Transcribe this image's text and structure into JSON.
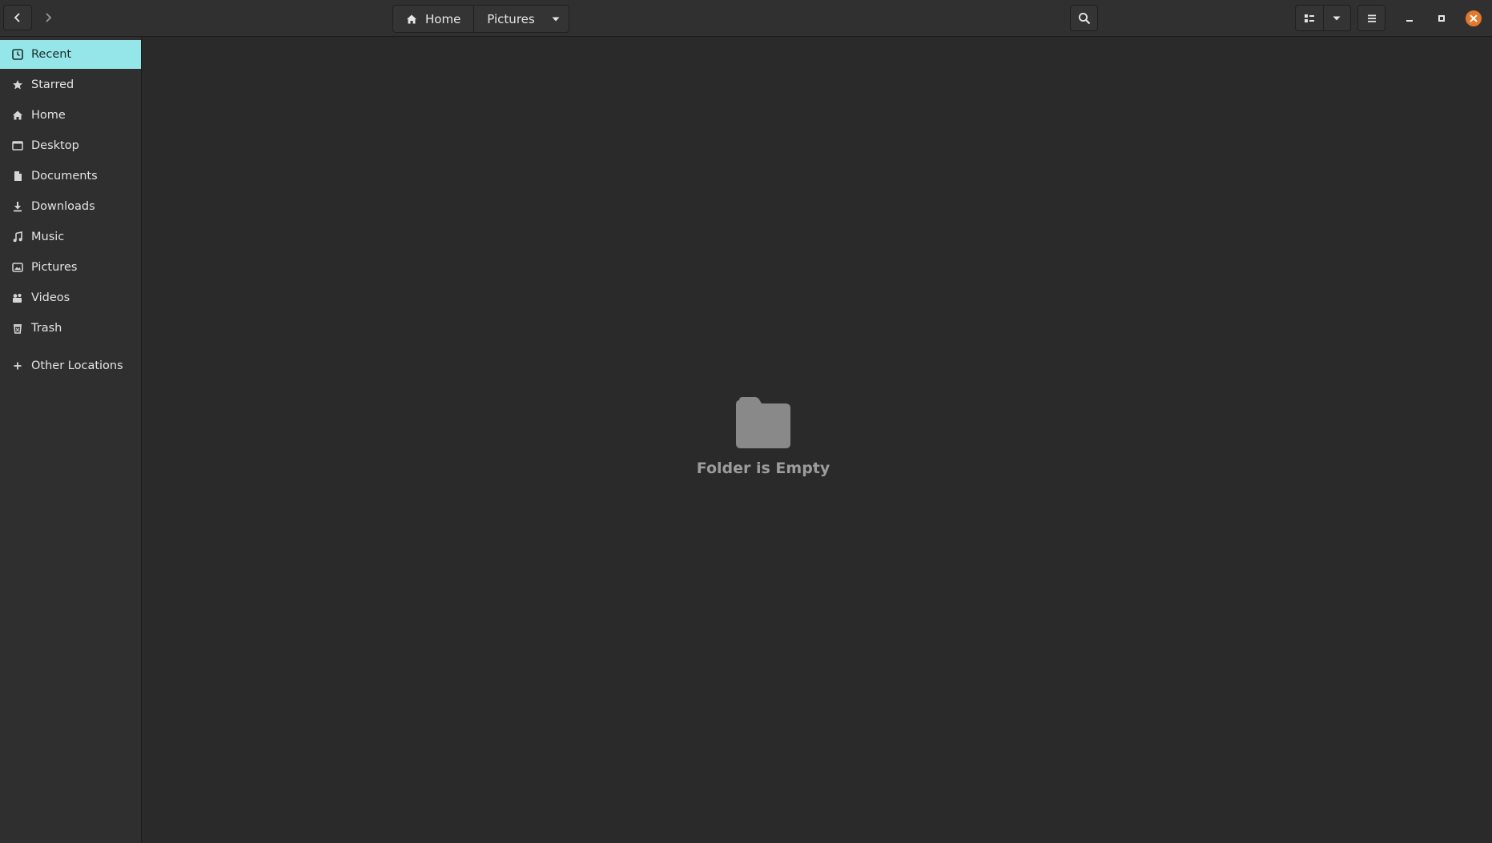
{
  "headerbar": {
    "back_icon": "go-previous-icon",
    "forward_icon": "go-next-icon",
    "breadcrumbs": [
      {
        "label": "Home",
        "icon": "home-icon"
      },
      {
        "label": "Pictures"
      }
    ],
    "search_icon": "search-icon",
    "view_mode_icon": "list-view-icon",
    "view_options_icon": "chevron-down-icon",
    "menu_icon": "hamburger-menu-icon",
    "close_color": "#e4772a"
  },
  "sidebar": {
    "accent_color": "#94e6e8",
    "items": [
      {
        "label": "Recent",
        "icon": "recent-icon",
        "active": true
      },
      {
        "label": "Starred",
        "icon": "star-icon"
      },
      {
        "label": "Home",
        "icon": "home-icon"
      },
      {
        "label": "Desktop",
        "icon": "desktop-icon"
      },
      {
        "label": "Documents",
        "icon": "document-icon"
      },
      {
        "label": "Downloads",
        "icon": "download-icon"
      },
      {
        "label": "Music",
        "icon": "music-icon"
      },
      {
        "label": "Pictures",
        "icon": "pictures-icon"
      },
      {
        "label": "Videos",
        "icon": "videos-icon"
      },
      {
        "label": "Trash",
        "icon": "trash-icon"
      },
      {
        "label": "Other Locations",
        "icon": "plus-icon"
      }
    ]
  },
  "main": {
    "empty_icon": "folder-icon",
    "empty_message": "Folder is Empty"
  }
}
